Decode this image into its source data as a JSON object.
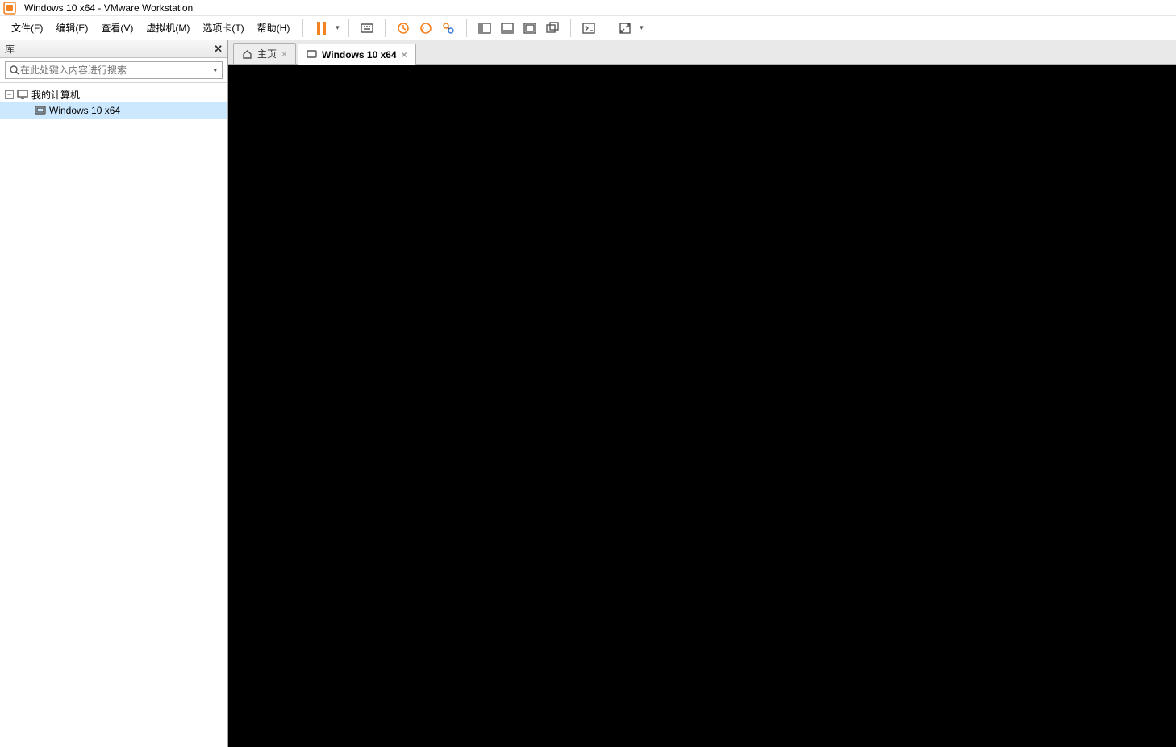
{
  "title": "Windows 10 x64 - VMware Workstation",
  "menu": {
    "file": "文件(F)",
    "edit": "编辑(E)",
    "view": "查看(V)",
    "vm": "虚拟机(M)",
    "tabs": "选项卡(T)",
    "help": "帮助(H)"
  },
  "sidebar": {
    "header": "库",
    "search_placeholder": "在此处键入内容进行搜索",
    "root": "我的计算机",
    "vm": "Windows 10 x64"
  },
  "tabs": {
    "home": "主页",
    "vm": "Windows 10 x64"
  },
  "icons": {
    "pause": "pause",
    "send_cad": "send-ctrl-alt-del",
    "snapshot": "snapshot",
    "revert": "revert-snapshot",
    "manage": "snapshot-manager",
    "show_lib": "show-library",
    "thumb": "thumbnail-bar",
    "hide_tabs": "hide-console-tabs",
    "new_window": "open-new-window",
    "unity": "unity-mode",
    "fullscreen": "fullscreen"
  }
}
